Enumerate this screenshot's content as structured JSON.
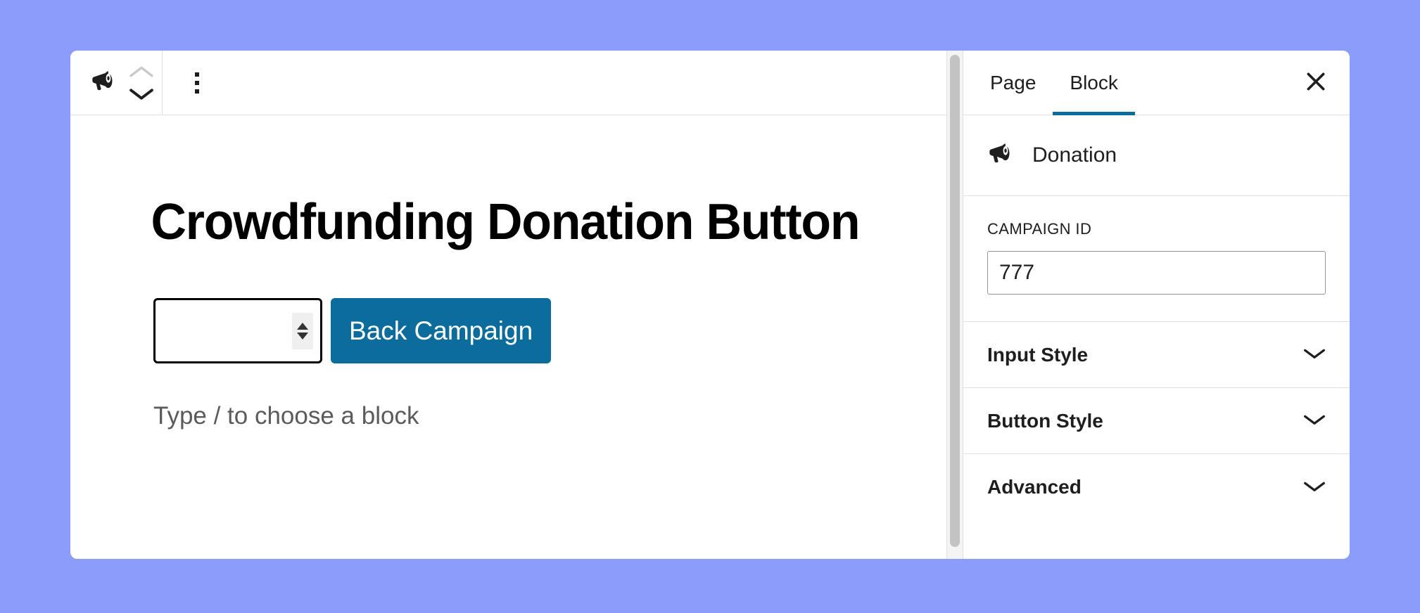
{
  "theme": {
    "page_background": "#8b9df8",
    "card_background": "#ffffff",
    "accent": "#0c6c9c",
    "border": "#e0e0e0",
    "text": "#1e1e1e",
    "placeholder_text": "#5b5b5b",
    "scrollbar_thumb": "#c3c3c3"
  },
  "toolbar": {
    "block_type_icon": "megaphone-icon",
    "move_up_icon": "chevron-up-icon",
    "move_down_icon": "chevron-down-icon",
    "options_icon": "kebab-menu-icon"
  },
  "editor": {
    "post_title": "Crowdfunding Donation Button",
    "donation": {
      "amount_value": "",
      "amount_placeholder": "",
      "stepper_icon": "spinner-arrows-icon",
      "button_label": "Back Campaign"
    },
    "empty_block_placeholder": "Type / to choose a block"
  },
  "sidebar": {
    "tabs": [
      {
        "label": "Page",
        "active": false
      },
      {
        "label": "Block",
        "active": true
      }
    ],
    "close_icon": "close-icon",
    "block_card": {
      "icon": "megaphone-icon",
      "title": "Donation"
    },
    "campaign": {
      "label": "CAMPAIGN ID",
      "value": "777",
      "placeholder": ""
    },
    "panels": [
      {
        "title": "Input Style",
        "icon": "chevron-down-icon"
      },
      {
        "title": "Button Style",
        "icon": "chevron-down-icon"
      },
      {
        "title": "Advanced",
        "icon": "chevron-down-icon"
      }
    ]
  }
}
